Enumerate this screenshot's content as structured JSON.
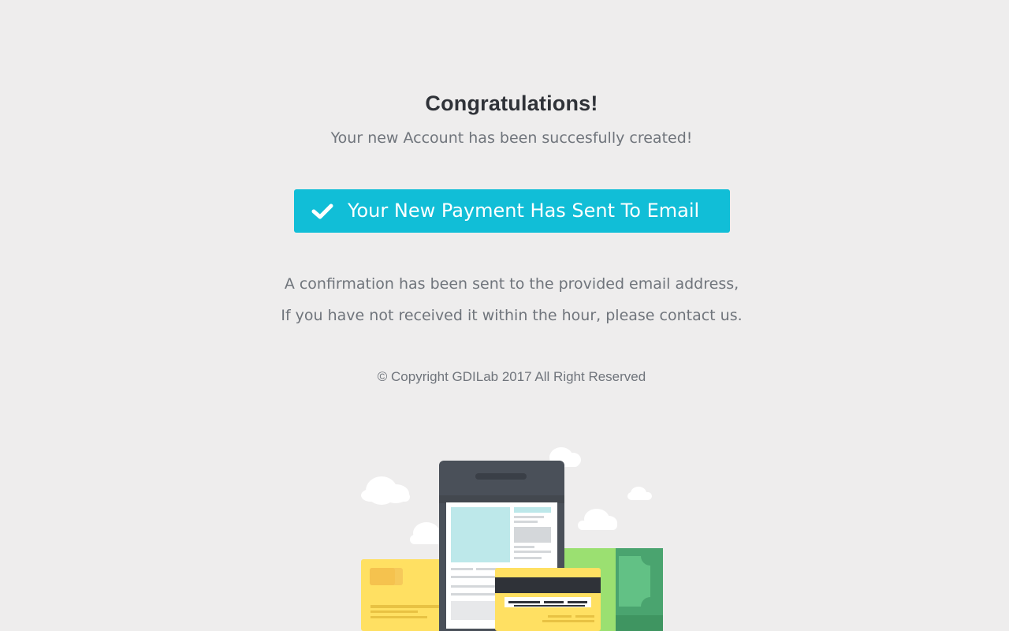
{
  "header": {
    "title": "Congratulations!",
    "subtitle": "Your new Account has been succesfully created!"
  },
  "banner": {
    "text": "Your New Payment Has Sent To Email",
    "icon": "check-icon",
    "color": "#11bed7"
  },
  "info": {
    "line1": "A confirmation has been sent to the provided email address,",
    "line2": "If you have not received it within the hour, please contact us."
  },
  "footer": {
    "copyright": "© Copyright GDILab 2017 All Right Reserved"
  },
  "illustration": {
    "icon": "payment-illustration"
  }
}
